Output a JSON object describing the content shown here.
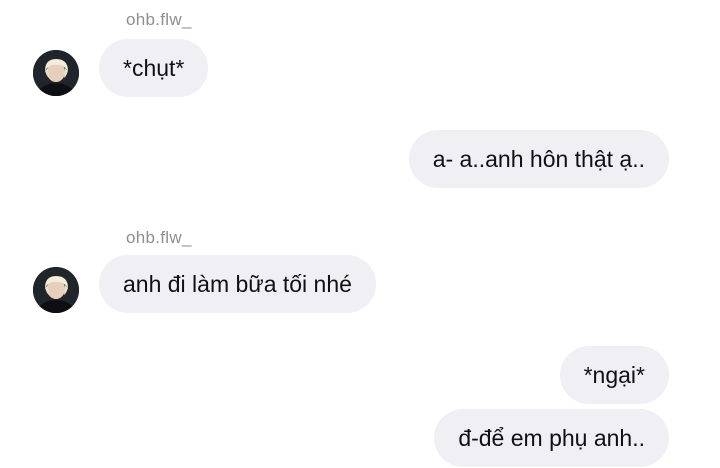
{
  "conversation": {
    "messages": [
      {
        "sender": "ohb.flw_",
        "direction": "incoming",
        "text": "*chụt*"
      },
      {
        "sender": "me",
        "direction": "outgoing",
        "text": "a- a..anh hôn thật ạ.."
      },
      {
        "sender": "ohb.flw_",
        "direction": "incoming",
        "text": "anh đi làm bữa tối nhé"
      },
      {
        "sender": "me",
        "direction": "outgoing",
        "text": "*ngại*"
      },
      {
        "sender": "me",
        "direction": "outgoing",
        "text": "đ-để em phụ anh.."
      }
    ]
  },
  "avatar_icon": "user-avatar-photo",
  "colors": {
    "bubble_background": "#efeff4",
    "message_text": "#111111",
    "sender_name": "#8e8e93",
    "background": "#ffffff"
  }
}
